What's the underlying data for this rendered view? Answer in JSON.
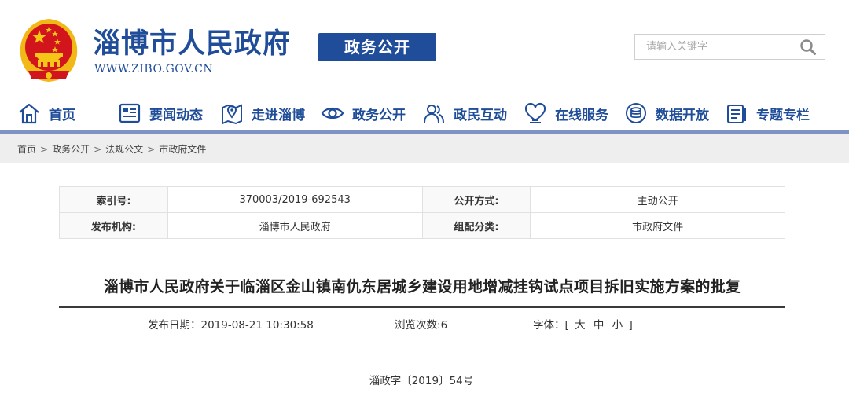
{
  "header": {
    "site_name": "淄博市人民政府",
    "site_url": "WWW.ZIBO.GOV.CN",
    "badge": "政务公开",
    "emblem_icon": "national-emblem-icon"
  },
  "search": {
    "placeholder": "请输入关键字",
    "icon": "search-icon"
  },
  "nav": {
    "items": [
      {
        "label": "首页",
        "icon": "home-icon"
      },
      {
        "label": "要闻动态",
        "icon": "news-icon"
      },
      {
        "label": "走进淄博",
        "icon": "map-pin-icon"
      },
      {
        "label": "政务公开",
        "icon": "eye-icon"
      },
      {
        "label": "政民互动",
        "icon": "people-icon"
      },
      {
        "label": "在线服务",
        "icon": "heart-service-icon"
      },
      {
        "label": "数据开放",
        "icon": "database-icon"
      },
      {
        "label": "专题专栏",
        "icon": "document-icon"
      }
    ]
  },
  "breadcrumb": {
    "items": [
      "首页",
      "政务公开",
      "法规公文",
      "市政府文件"
    ],
    "separator": ">"
  },
  "info": {
    "index_label": "索引号:",
    "index_value": "370003/2019-692543",
    "open_mode_label": "公开方式:",
    "open_mode_value": "主动公开",
    "publisher_label": "发布机构:",
    "publisher_value": "淄博市人民政府",
    "category_label": "组配分类:",
    "category_value": "市政府文件"
  },
  "article": {
    "title": "淄博市人民政府关于临淄区金山镇南仇东居城乡建设用地增减挂钩试点项目拆旧实施方案的批复",
    "date_label": "发布日期：",
    "date_value": "2019-08-21 10:30:58",
    "views_label": "浏览次数:",
    "views_value": "6",
    "font_label": "字体：[",
    "font_large": "大",
    "font_medium": "中",
    "font_small": "小",
    "font_close": "]",
    "doc_number": "淄政字〔2019〕54号"
  },
  "colors": {
    "brand_blue": "#1f4d99",
    "nav_bar": "#7d93c4",
    "emblem_red": "#c8161d",
    "emblem_gold": "#f5c518"
  }
}
